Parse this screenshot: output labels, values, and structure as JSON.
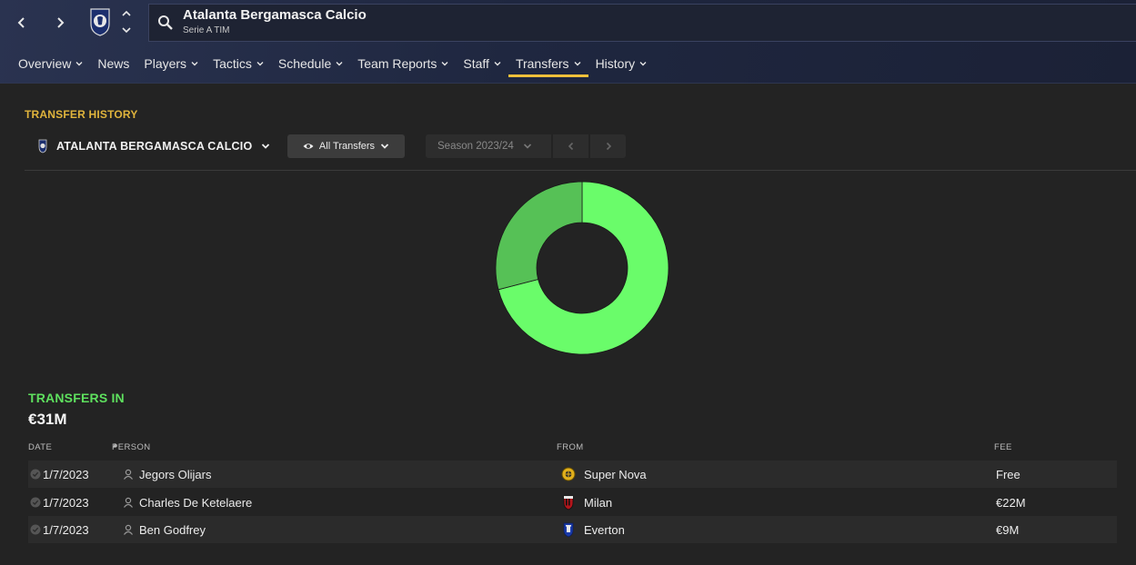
{
  "header": {
    "search": {
      "title": "Atalanta Bergamasca Calcio",
      "subtitle": "Serie A TIM"
    },
    "tabs": [
      {
        "label": "Overview",
        "dropdown": true,
        "active": false
      },
      {
        "label": "News",
        "dropdown": false,
        "active": false
      },
      {
        "label": "Players",
        "dropdown": true,
        "active": false
      },
      {
        "label": "Tactics",
        "dropdown": true,
        "active": false
      },
      {
        "label": "Schedule",
        "dropdown": true,
        "active": false
      },
      {
        "label": "Team Reports",
        "dropdown": true,
        "active": false
      },
      {
        "label": "Staff",
        "dropdown": true,
        "active": false
      },
      {
        "label": "Transfers",
        "dropdown": true,
        "active": true
      },
      {
        "label": "History",
        "dropdown": true,
        "active": false
      }
    ]
  },
  "section": {
    "title": "TRANSFER HISTORY",
    "club_select": "ATALANTA BERGAMASCA CALCIO",
    "filter_label": "All Transfers",
    "season_label": "Season 2023/24"
  },
  "chart_data": {
    "type": "pie",
    "style": "donut",
    "categories": [
      "Charles De Ketelaere",
      "Ben Godfrey",
      "Jegors Olijars"
    ],
    "values": [
      22,
      9,
      0
    ],
    "unit": "€M",
    "colors": [
      "#6afc6a",
      "#56c156",
      "#4aa34a"
    ],
    "title": "",
    "xlabel": "",
    "ylabel": ""
  },
  "transfers_in": {
    "title": "TRANSFERS IN",
    "total": "€31M",
    "columns": {
      "date": "DATE",
      "person": "PERSON",
      "from": "FROM",
      "fee": "FEE"
    },
    "rows": [
      {
        "date": "1/7/2023",
        "person": "Jegors Olijars",
        "from": "Super Nova",
        "fee": "Free",
        "badge": "supernova-badge-icon"
      },
      {
        "date": "1/7/2023",
        "person": "Charles De Ketelaere",
        "from": "Milan",
        "fee": "€22M",
        "badge": "milan-badge-icon"
      },
      {
        "date": "1/7/2023",
        "person": "Ben Godfrey",
        "from": "Everton",
        "fee": "€9M",
        "badge": "everton-badge-icon"
      }
    ]
  },
  "colors": {
    "accent": "#f0c03a",
    "section_title": "#e0b43c",
    "transfers_in": "#5ee05e"
  }
}
